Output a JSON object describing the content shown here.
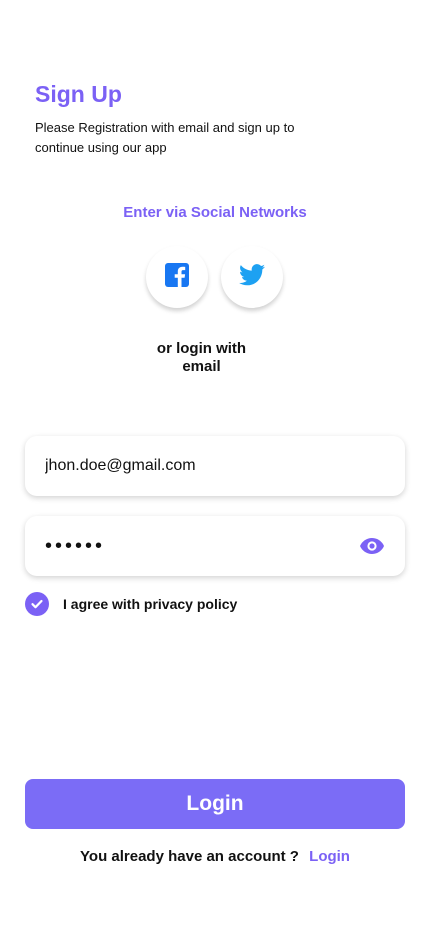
{
  "header": {
    "title": "Sign Up",
    "subtitle": "Please Registration with email and sign up to continue using our app"
  },
  "social": {
    "heading": "Enter via Social Networks",
    "buttons": [
      {
        "icon": "facebook-icon",
        "color": "#1877f2"
      },
      {
        "icon": "twitter-icon",
        "color": "#1da1f2"
      }
    ]
  },
  "divider": {
    "line1": "or login with",
    "line2": "email"
  },
  "form": {
    "email_value": "jhon.doe@gmail.com",
    "password_value": "••••••",
    "password_toggle_icon": "eye-icon",
    "agree_checked": true,
    "agree_label": "I agree with privacy policy"
  },
  "actions": {
    "login_label": "Login"
  },
  "footer": {
    "prompt": "You already have an account ?",
    "link": "Login"
  },
  "colors": {
    "accent": "#7b61f5",
    "button": "#7b6cf6"
  }
}
